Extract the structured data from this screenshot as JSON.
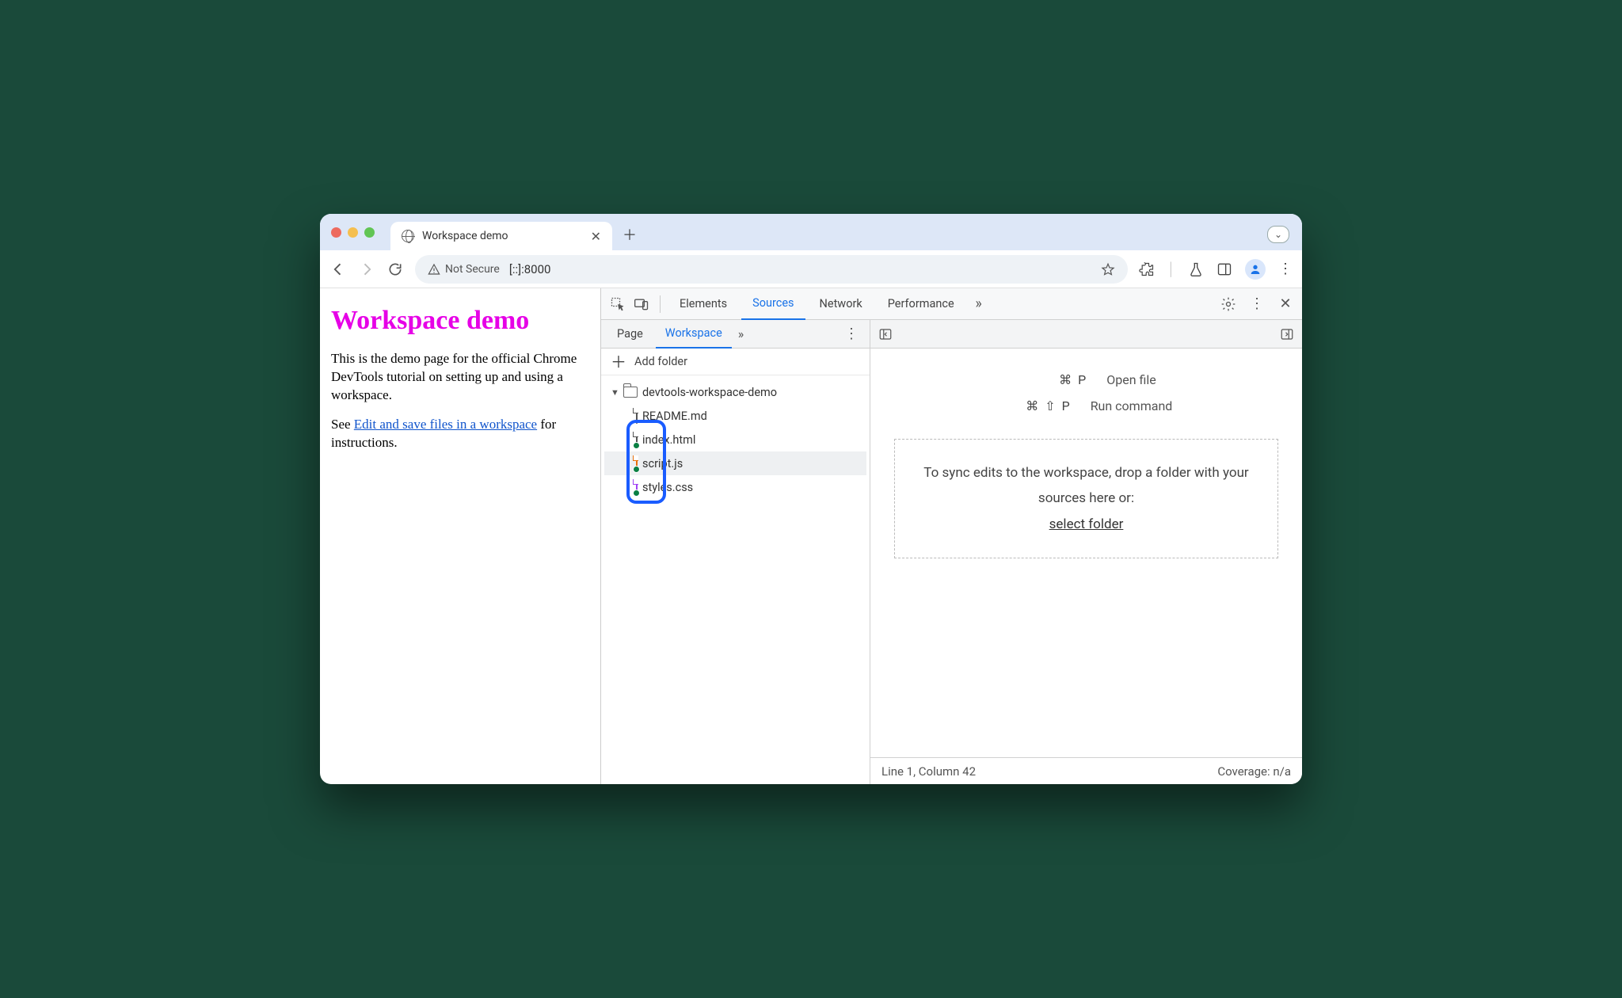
{
  "browser": {
    "tab_title": "Workspace demo",
    "security_label": "Not Secure",
    "url": "[::]:8000"
  },
  "page": {
    "heading": "Workspace demo",
    "p1": "This is the demo page for the official Chrome DevTools tutorial on setting up and using a workspace.",
    "p2_pre": "See ",
    "p2_link": "Edit and save files in a workspace",
    "p2_post": " for instructions."
  },
  "devtools": {
    "tabs": {
      "elements": "Elements",
      "sources": "Sources",
      "network": "Network",
      "performance": "Performance"
    },
    "sources": {
      "subtabs": {
        "page": "Page",
        "workspace": "Workspace"
      },
      "add_folder": "Add folder",
      "tree": {
        "root": "devtools-workspace-demo",
        "files": [
          "README.md",
          "index.html",
          "script.js",
          "styles.css"
        ]
      },
      "shortcuts": {
        "open_file_keys": "⌘ P",
        "open_file_label": "Open file",
        "run_cmd_keys": "⌘ ⇧ P",
        "run_cmd_label": "Run command"
      },
      "dropzone": {
        "text": "To sync edits to the workspace, drop a folder with your sources here or:",
        "link": "select folder"
      },
      "status": {
        "position": "Line 1, Column 42",
        "coverage": "Coverage: n/a"
      }
    }
  }
}
